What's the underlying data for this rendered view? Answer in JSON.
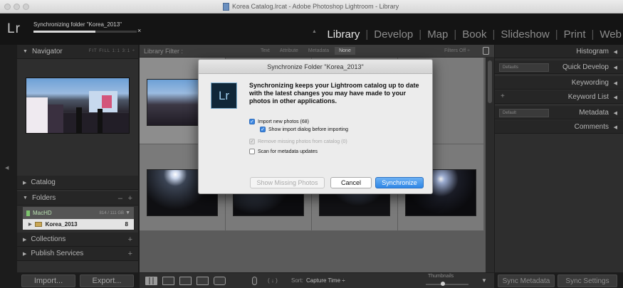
{
  "window": {
    "title": "Korea Catalog.lrcat - Adobe Photoshop Lightroom - Library"
  },
  "identity": {
    "logo": "Lr",
    "sync_status": "Synchronizing folder \"Korea_2013\"",
    "sync_progress": 0.6,
    "close_glyph": "×",
    "collapse_glyph": "▲"
  },
  "modules": [
    {
      "label": "Library",
      "active": true
    },
    {
      "label": "Develop"
    },
    {
      "label": "Map"
    },
    {
      "label": "Book"
    },
    {
      "label": "Slideshow"
    },
    {
      "label": "Print"
    },
    {
      "label": "Web"
    }
  ],
  "left_panel": {
    "navigator": {
      "title": "Navigator",
      "zoom_options": "FIT   FILL   1:1   3:1 ÷"
    },
    "catalog": {
      "title": "Catalog"
    },
    "folders": {
      "title": "Folders",
      "minus": "–",
      "plus": "+"
    },
    "drive": {
      "name": "MacHD",
      "size": "814 / 111 GB"
    },
    "folder": {
      "name": "Korea_2013",
      "count": "8"
    },
    "collections": {
      "title": "Collections",
      "plus": "+"
    },
    "publish": {
      "title": "Publish Services",
      "plus": "+"
    },
    "import_label": "Import...",
    "export_label": "Export..."
  },
  "filter_bar": {
    "label": "Library Filter :",
    "tabs": [
      "Text",
      "Attribute",
      "Metadata",
      "None"
    ],
    "active_tab": "None",
    "filters_off": "Filters Off ÷"
  },
  "toolbar": {
    "sort_label": "Sort:",
    "sort_value": "Capture Time ÷",
    "thumbnails_label": "Thumbnails",
    "thumbnail_size": 0.4,
    "dropdown_glyph": "▼"
  },
  "right_panel": {
    "histogram": "Histogram",
    "quick_develop": "Quick Develop",
    "quick_develop_preset": "Defaults",
    "keywording": "Keywording",
    "keyword_list": "Keyword List",
    "metadata": "Metadata",
    "metadata_preset": "Default",
    "comments": "Comments",
    "sync_metadata": "Sync Metadata",
    "sync_settings": "Sync Settings"
  },
  "dialog": {
    "title": "Synchronize Folder \"Korea_2013\"",
    "logo": "Lr",
    "message": "Synchronizing keeps your Lightroom catalog up to date with the latest changes you may have made to your photos in other applications.",
    "options": {
      "import_new": {
        "label": "Import new photos (68)",
        "checked": true
      },
      "show_import": {
        "label": "Show import dialog before importing",
        "checked": true
      },
      "remove_missing": {
        "label": "Remove missing photos from catalog (0)",
        "checked": true,
        "disabled": true
      },
      "scan_metadata": {
        "label": "Scan for metadata updates",
        "checked": false
      }
    },
    "show_missing_label": "Show Missing Photos",
    "cancel_label": "Cancel",
    "synchronize_label": "Synchronize"
  },
  "colors": {
    "accent": "#3b86e0",
    "panel": "#2e2e2e",
    "grid": "#5b5b5b"
  }
}
